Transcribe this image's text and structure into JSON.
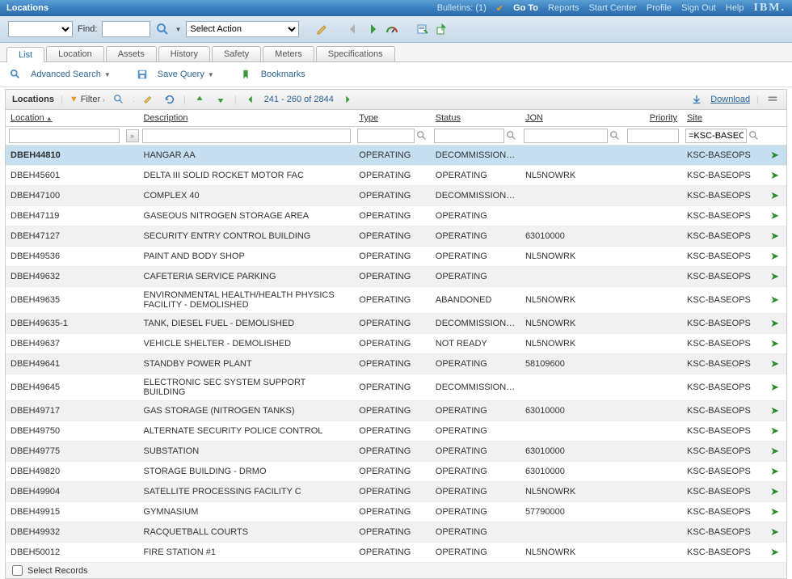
{
  "header": {
    "title": "Locations",
    "bulletins": "Bulletins: (1)",
    "goto": "Go To",
    "links": [
      "Reports",
      "Start Center",
      "Profile",
      "Sign Out",
      "Help"
    ],
    "logo": "IBM."
  },
  "toolbar": {
    "find_label": "Find:",
    "select_action": "Select Action"
  },
  "tabs": [
    "List",
    "Location",
    "Assets",
    "History",
    "Safety",
    "Meters",
    "Specifications"
  ],
  "tabs_active": 0,
  "sec_toolbar": {
    "advanced_search": "Advanced Search",
    "save_query": "Save Query",
    "bookmarks": "Bookmarks"
  },
  "table_bar": {
    "title": "Locations",
    "filter": "Filter",
    "range": "241 - 260 of 2844",
    "download": "Download"
  },
  "columns": {
    "location": "Location",
    "description": "Description",
    "type": "Type",
    "status": "Status",
    "jon": "JON",
    "priority": "Priority",
    "site": "Site"
  },
  "filters": {
    "site_value": "=KSC-BASEOPS"
  },
  "rows": [
    {
      "loc": "DBEH44810",
      "desc": "HANGAR AA",
      "type": "OPERATING",
      "status": "DECOMMISSIONED",
      "jon": "",
      "prio": "",
      "site": "KSC-BASEOPS",
      "sel": true
    },
    {
      "loc": "DBEH45601",
      "desc": "DELTA III SOLID ROCKET MOTOR FAC",
      "type": "OPERATING",
      "status": "OPERATING",
      "jon": "NL5NOWRK",
      "prio": "",
      "site": "KSC-BASEOPS"
    },
    {
      "loc": "DBEH47100",
      "desc": "COMPLEX 40",
      "type": "OPERATING",
      "status": "DECOMMISSIONED",
      "jon": "",
      "prio": "",
      "site": "KSC-BASEOPS"
    },
    {
      "loc": "DBEH47119",
      "desc": "GASEOUS NITROGEN STORAGE AREA",
      "type": "OPERATING",
      "status": "OPERATING",
      "jon": "",
      "prio": "",
      "site": "KSC-BASEOPS"
    },
    {
      "loc": "DBEH47127",
      "desc": "SECURITY ENTRY CONTROL BUILDING",
      "type": "OPERATING",
      "status": "OPERATING",
      "jon": "63010000",
      "prio": "",
      "site": "KSC-BASEOPS"
    },
    {
      "loc": "DBEH49536",
      "desc": "PAINT AND BODY SHOP",
      "type": "OPERATING",
      "status": "OPERATING",
      "jon": "NL5NOWRK",
      "prio": "",
      "site": "KSC-BASEOPS"
    },
    {
      "loc": "DBEH49632",
      "desc": "CAFETERIA SERVICE PARKING",
      "type": "OPERATING",
      "status": "OPERATING",
      "jon": "",
      "prio": "",
      "site": "KSC-BASEOPS"
    },
    {
      "loc": "DBEH49635",
      "desc": "ENVIRONMENTAL HEALTH/HEALTH PHYSICS FACILITY - DEMOLISHED",
      "type": "OPERATING",
      "status": "ABANDONED",
      "jon": "NL5NOWRK",
      "prio": "",
      "site": "KSC-BASEOPS"
    },
    {
      "loc": "DBEH49635-1",
      "desc": "TANK, DIESEL FUEL - DEMOLISHED",
      "type": "OPERATING",
      "status": "DECOMMISSIONED",
      "jon": "NL5NOWRK",
      "prio": "",
      "site": "KSC-BASEOPS"
    },
    {
      "loc": "DBEH49637",
      "desc": "VEHICLE SHELTER - DEMOLISHED",
      "type": "OPERATING",
      "status": "NOT READY",
      "jon": "NL5NOWRK",
      "prio": "",
      "site": "KSC-BASEOPS"
    },
    {
      "loc": "DBEH49641",
      "desc": "STANDBY POWER PLANT",
      "type": "OPERATING",
      "status": "OPERATING",
      "jon": "58109600",
      "prio": "",
      "site": "KSC-BASEOPS"
    },
    {
      "loc": "DBEH49645",
      "desc": "ELECTRONIC SEC SYSTEM SUPPORT BUILDING",
      "type": "OPERATING",
      "status": "DECOMMISSIONED",
      "jon": "",
      "prio": "",
      "site": "KSC-BASEOPS"
    },
    {
      "loc": "DBEH49717",
      "desc": "GAS STORAGE (NITROGEN TANKS)",
      "type": "OPERATING",
      "status": "OPERATING",
      "jon": "63010000",
      "prio": "",
      "site": "KSC-BASEOPS"
    },
    {
      "loc": "DBEH49750",
      "desc": "ALTERNATE SECURITY POLICE CONTROL",
      "type": "OPERATING",
      "status": "OPERATING",
      "jon": "",
      "prio": "",
      "site": "KSC-BASEOPS"
    },
    {
      "loc": "DBEH49775",
      "desc": "SUBSTATION",
      "type": "OPERATING",
      "status": "OPERATING",
      "jon": "63010000",
      "prio": "",
      "site": "KSC-BASEOPS"
    },
    {
      "loc": "DBEH49820",
      "desc": "STORAGE BUILDING - DRMO",
      "type": "OPERATING",
      "status": "OPERATING",
      "jon": "63010000",
      "prio": "",
      "site": "KSC-BASEOPS"
    },
    {
      "loc": "DBEH49904",
      "desc": "SATELLITE PROCESSING FACILITY C",
      "type": "OPERATING",
      "status": "OPERATING",
      "jon": "NL5NOWRK",
      "prio": "",
      "site": "KSC-BASEOPS"
    },
    {
      "loc": "DBEH49915",
      "desc": "GYMNASIUM",
      "type": "OPERATING",
      "status": "OPERATING",
      "jon": "57790000",
      "prio": "",
      "site": "KSC-BASEOPS"
    },
    {
      "loc": "DBEH49932",
      "desc": "RACQUETBALL COURTS",
      "type": "OPERATING",
      "status": "OPERATING",
      "jon": "",
      "prio": "",
      "site": "KSC-BASEOPS"
    },
    {
      "loc": "DBEH50012",
      "desc": "FIRE STATION #1",
      "type": "OPERATING",
      "status": "OPERATING",
      "jon": "NL5NOWRK",
      "prio": "",
      "site": "KSC-BASEOPS"
    }
  ],
  "footer": {
    "select_records": "Select Records"
  }
}
